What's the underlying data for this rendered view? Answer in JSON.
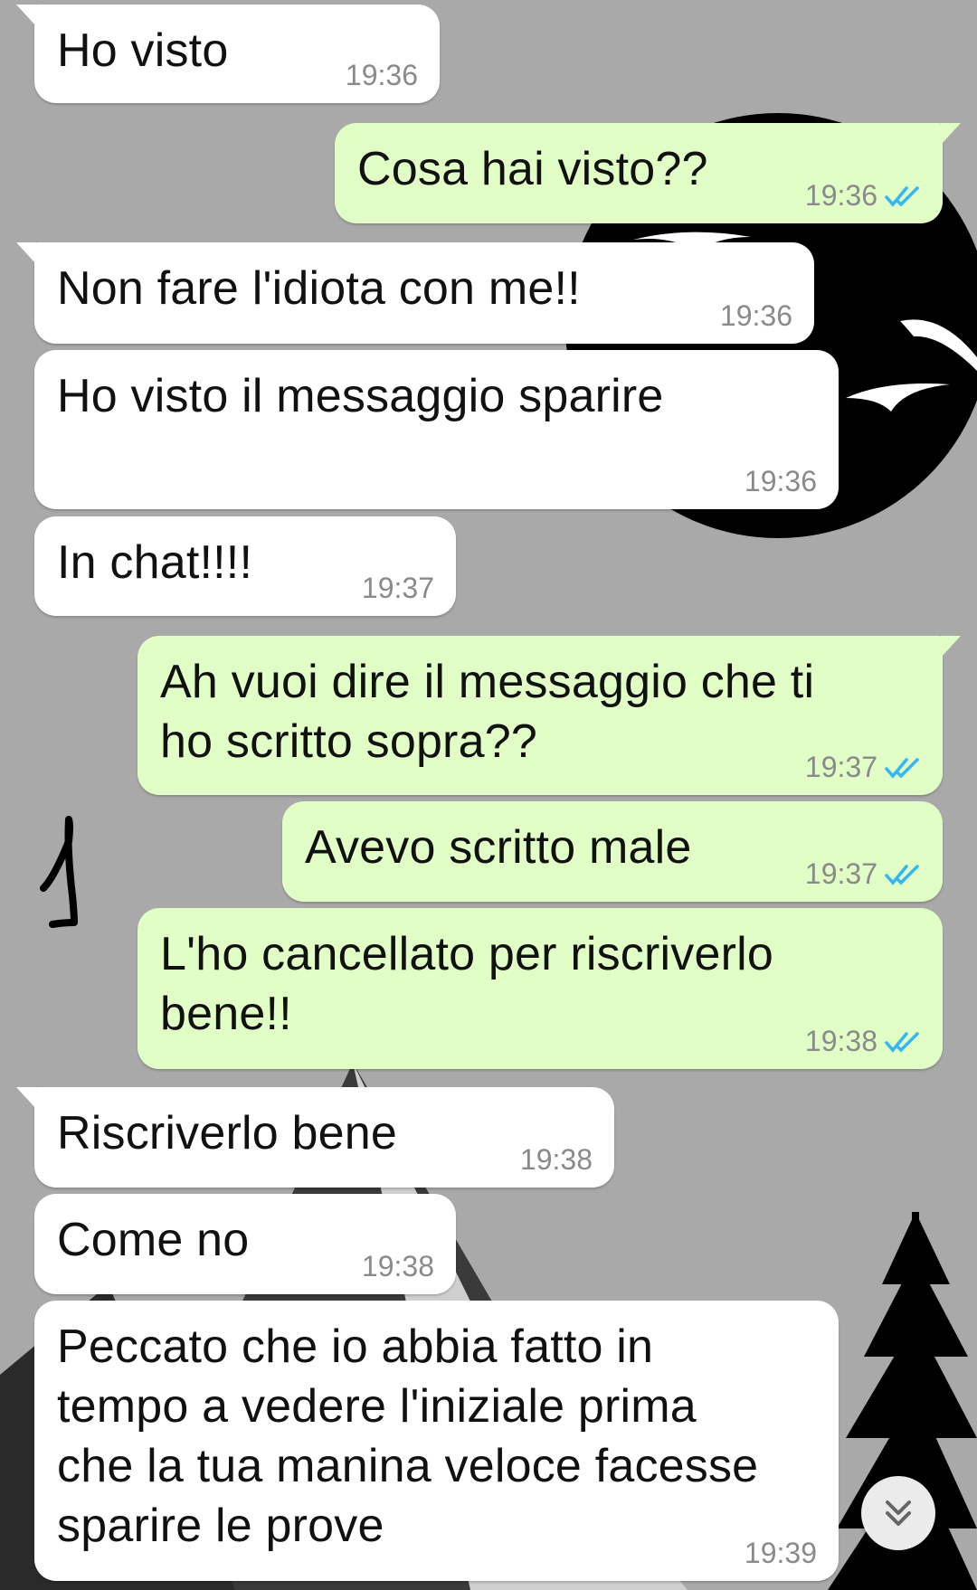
{
  "colors": {
    "background": "#a9a9a9",
    "incoming_bubble": "#ffffff",
    "outgoing_bubble": "#e1fec6",
    "read_ticks": "#34b7f1",
    "timestamp": "#8a8a8a"
  },
  "annotation": {
    "handwritten_mark": "1"
  },
  "messages": [
    {
      "text": "Ho visto",
      "time": "19:36",
      "direction": "incoming"
    },
    {
      "text": "Cosa hai visto??",
      "time": "19:36",
      "direction": "outgoing",
      "status": "read"
    },
    {
      "text": "Non fare l'idiota con me!!",
      "time": "19:36",
      "direction": "incoming"
    },
    {
      "text": "Ho visto il messaggio sparire",
      "time": "19:36",
      "direction": "incoming"
    },
    {
      "text": "In chat!!!!",
      "time": "19:37",
      "direction": "incoming"
    },
    {
      "text": "Ah vuoi dire il messaggio che ti\nho scritto sopra??",
      "time": "19:37",
      "direction": "outgoing",
      "status": "read"
    },
    {
      "text": "Avevo scritto male",
      "time": "19:37",
      "direction": "outgoing",
      "status": "read"
    },
    {
      "text": "L'ho cancellato per riscriverlo\nbene!!",
      "time": "19:38",
      "direction": "outgoing",
      "status": "read"
    },
    {
      "text": "Riscriverlo bene",
      "time": "19:38",
      "direction": "incoming"
    },
    {
      "text": "Come no",
      "time": "19:38",
      "direction": "incoming"
    },
    {
      "text": "Peccato che io abbia fatto in\ntempo a vedere l'iniziale prima\nche la tua manina veloce facesse\nsparire le prove",
      "time": "19:39",
      "direction": "incoming"
    }
  ],
  "scroll_button": {
    "icon": "double-chevron-down-icon"
  }
}
